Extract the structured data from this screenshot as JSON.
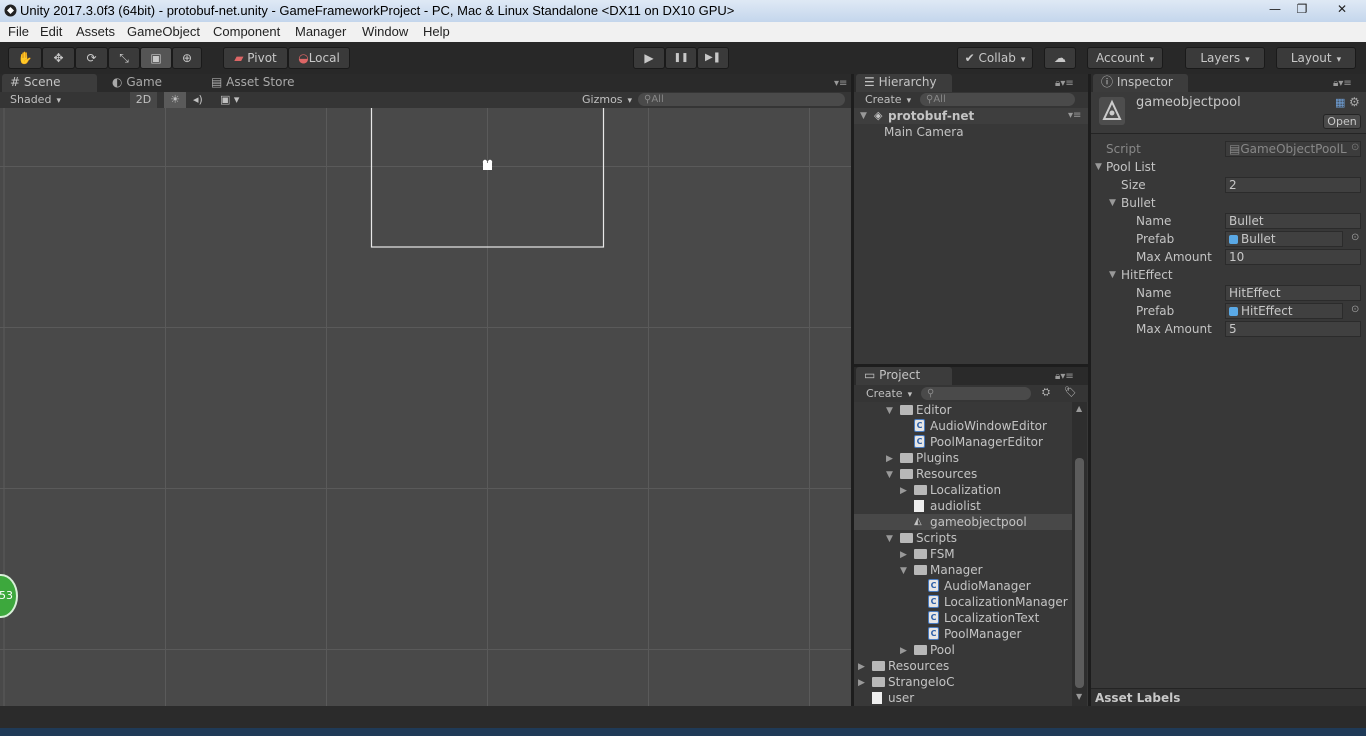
{
  "window": {
    "title": "Unity 2017.3.0f3 (64bit) - protobuf-net.unity - GameFrameworkProject - PC, Mac & Linux Standalone <DX11 on DX10 GPU>",
    "minimize": "—",
    "restore": "❐",
    "close": "✕"
  },
  "menu": [
    "File",
    "Edit",
    "Assets",
    "GameObject",
    "Component",
    "Manager",
    "Window",
    "Help"
  ],
  "toolbar": {
    "tools": [
      "hand-tool",
      "move-tool",
      "rotate-tool",
      "scale-tool",
      "rect-tool",
      "transform-tool"
    ],
    "pivot": "Pivot",
    "local": "Local",
    "play": "▶",
    "pause": "❚❚",
    "step": "▶❚",
    "collab": "Collab",
    "account": "Account",
    "layers": "Layers",
    "layout": "Layout"
  },
  "scene": {
    "tabs": [
      "Scene",
      "Game",
      "Asset Store"
    ],
    "shading": "Shaded",
    "mode2d": "2D",
    "gizmos": "Gizmos",
    "search_placeholder": "All",
    "badge": "53"
  },
  "hierarchy": {
    "tab": "Hierarchy",
    "create": "Create",
    "search_placeholder": "All",
    "scene_name": "protobuf-net",
    "items": [
      "Main Camera"
    ]
  },
  "project": {
    "tab": "Project",
    "create": "Create",
    "items": [
      {
        "label": "Editor",
        "kind": "folder",
        "depth": 1,
        "fold": "open"
      },
      {
        "label": "AudioWindowEditor",
        "kind": "script",
        "depth": 2,
        "fold": ""
      },
      {
        "label": "PoolManagerEditor",
        "kind": "script",
        "depth": 2,
        "fold": ""
      },
      {
        "label": "Plugins",
        "kind": "folder",
        "depth": 1,
        "fold": "closed"
      },
      {
        "label": "Resources",
        "kind": "folder",
        "depth": 1,
        "fold": "open"
      },
      {
        "label": "Localization",
        "kind": "folder",
        "depth": 2,
        "fold": "closed"
      },
      {
        "label": "audiolist",
        "kind": "text",
        "depth": 2,
        "fold": ""
      },
      {
        "label": "gameobjectpool",
        "kind": "asset",
        "depth": 2,
        "fold": "",
        "selected": true
      },
      {
        "label": "Scripts",
        "kind": "folder",
        "depth": 1,
        "fold": "open"
      },
      {
        "label": "FSM",
        "kind": "folder",
        "depth": 2,
        "fold": "closed"
      },
      {
        "label": "Manager",
        "kind": "folder",
        "depth": 2,
        "fold": "open"
      },
      {
        "label": "AudioManager",
        "kind": "script",
        "depth": 3,
        "fold": ""
      },
      {
        "label": "LocalizationManager",
        "kind": "script",
        "depth": 3,
        "fold": ""
      },
      {
        "label": "LocalizationText",
        "kind": "script",
        "depth": 3,
        "fold": ""
      },
      {
        "label": "PoolManager",
        "kind": "script",
        "depth": 3,
        "fold": ""
      },
      {
        "label": "Pool",
        "kind": "folder",
        "depth": 2,
        "fold": "closed"
      },
      {
        "label": "Resources",
        "kind": "folder",
        "depth": 0,
        "fold": "closed"
      },
      {
        "label": "StrangeIoC",
        "kind": "folder",
        "depth": 0,
        "fold": "closed"
      },
      {
        "label": "user",
        "kind": "file",
        "depth": 0,
        "fold": ""
      }
    ]
  },
  "inspector": {
    "tab": "Inspector",
    "object_name": "gameobjectpool",
    "open": "Open",
    "script_label": "Script",
    "script_value": "GameObjectPoolL",
    "pool_list": "Pool List",
    "size_label": "Size",
    "size_value": "2",
    "entries": [
      {
        "header": "Bullet",
        "name_label": "Name",
        "name": "Bullet",
        "prefab_label": "Prefab",
        "prefab": "Bullet",
        "max_label": "Max Amount",
        "max": "10"
      },
      {
        "header": "HitEffect",
        "name_label": "Name",
        "name": "HitEffect",
        "prefab_label": "Prefab",
        "prefab": "HitEffect",
        "max_label": "Max Amount",
        "max": "5"
      }
    ],
    "asset_labels": "Asset Labels"
  }
}
